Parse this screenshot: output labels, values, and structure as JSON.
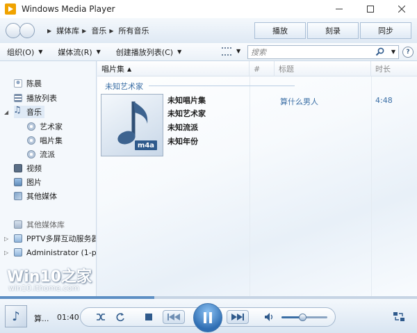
{
  "window": {
    "title": "Windows Media Player",
    "controls": [
      "minimize",
      "maximize",
      "close"
    ]
  },
  "nav": {
    "breadcrumbs": [
      "媒体库",
      "音乐",
      "所有音乐"
    ],
    "tabs": [
      "播放",
      "刻录",
      "同步"
    ]
  },
  "toolbar": {
    "organize": "组织(O)",
    "stream": "媒体流(R)",
    "create_playlist": "创建播放列表(C)",
    "search_placeholder": "搜索"
  },
  "sidebar": {
    "items": [
      {
        "label": "陈晨",
        "icon": "person-icon"
      },
      {
        "label": "播放列表",
        "icon": "playlist-icon"
      },
      {
        "label": "音乐",
        "icon": "music-icon"
      },
      {
        "label": "艺术家",
        "icon": "artist-icon"
      },
      {
        "label": "唱片集",
        "icon": "album-icon"
      },
      {
        "label": "流派",
        "icon": "genre-icon"
      },
      {
        "label": "视频",
        "icon": "video-icon"
      },
      {
        "label": "图片",
        "icon": "picture-icon"
      },
      {
        "label": "其他媒体",
        "icon": "other-media-icon"
      },
      {
        "label": "其他媒体库",
        "icon": "other-library-icon"
      },
      {
        "label": "PPTV多屏互动服务器",
        "icon": "server-icon"
      },
      {
        "label": "Administrator (1-p",
        "icon": "computer-icon"
      }
    ]
  },
  "columns": {
    "album": "唱片集",
    "number": "#",
    "title": "标题",
    "length": "时长"
  },
  "group": {
    "artist_heading": "未知艺术家",
    "album_meta": [
      "未知唱片集",
      "未知艺术家",
      "未知流派",
      "未知年份"
    ],
    "badge": "m4a"
  },
  "track": {
    "title": "算什么男人",
    "length": "4:48"
  },
  "now_playing": {
    "title": "算...",
    "time": "01:40",
    "progress": 0.37,
    "volume": 0.45
  },
  "watermark": {
    "line1": "Win10之家",
    "line2": "win10.ithome.com"
  },
  "colors": {
    "accent": "#3a6ea5",
    "play_button": "#2f6eb3"
  }
}
